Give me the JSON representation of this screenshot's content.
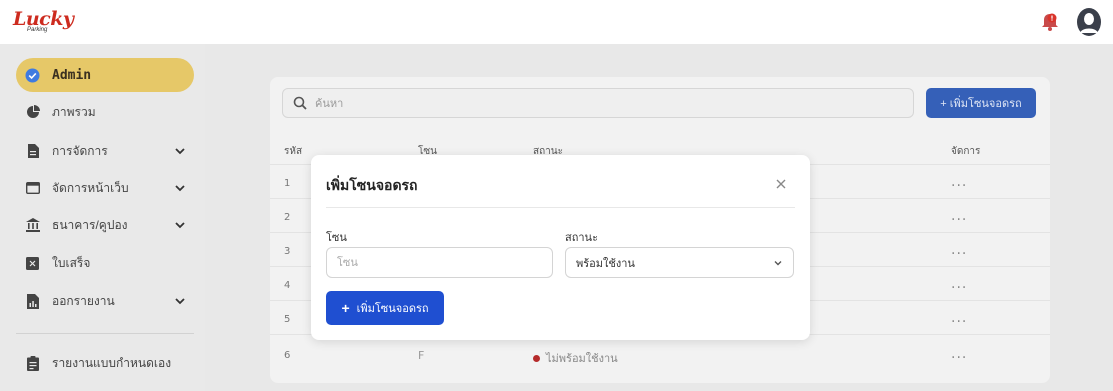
{
  "brand": {
    "logo_text": "Lucky",
    "logo_sub": "Parking"
  },
  "header": {
    "bell_icon": "bell-icon",
    "avatar_icon": "user-avatar-icon"
  },
  "sidebar": {
    "items": [
      {
        "label": "Admin",
        "icon": "shield-check-icon",
        "active": true
      },
      {
        "label": "ภาพรวม",
        "icon": "pie-chart-icon"
      },
      {
        "label": "การจัดการ",
        "icon": "document-icon",
        "expandable": true
      },
      {
        "label": "จัดการหน้าเว็บ",
        "icon": "window-icon",
        "expandable": true
      },
      {
        "label": "ธนาคาร/คูปอง",
        "icon": "bank-icon",
        "expandable": true
      },
      {
        "label": "ใบเสร็จ",
        "icon": "receipt-icon"
      },
      {
        "label": "ออกรายงาน",
        "icon": "report-icon",
        "expandable": true
      },
      {
        "label": "รายงานแบบกำหนดเอง",
        "icon": "clipboard-icon"
      }
    ]
  },
  "main": {
    "search_placeholder": "ค้นหา",
    "add_button": "+ เพิ่มโซนจอดรถ",
    "table": {
      "headers": [
        "รหัส",
        "โซน",
        "สถานะ",
        "จัดการ"
      ],
      "rows": [
        {
          "id": "1"
        },
        {
          "id": "2"
        },
        {
          "id": "3"
        },
        {
          "id": "4"
        },
        {
          "id": "5"
        },
        {
          "id": "6",
          "zone": "F",
          "status": "ไม่พร้อมใช้งาน"
        }
      ],
      "actions": "..."
    }
  },
  "modal": {
    "title": "เพิ่มโซนจอดรถ",
    "zone_label": "โซน",
    "zone_placeholder": "โซน",
    "status_label": "สถานะ",
    "status_value": "พร้อมใช้งาน",
    "submit_label": "เพิ่มโซนจอดรถ",
    "submit_plus": "+"
  },
  "colors": {
    "brand_red": "#cd2b1f",
    "active_gold": "#e6c868",
    "primary_blue": "#1f4fd1",
    "status_red": "#b52b2b"
  }
}
